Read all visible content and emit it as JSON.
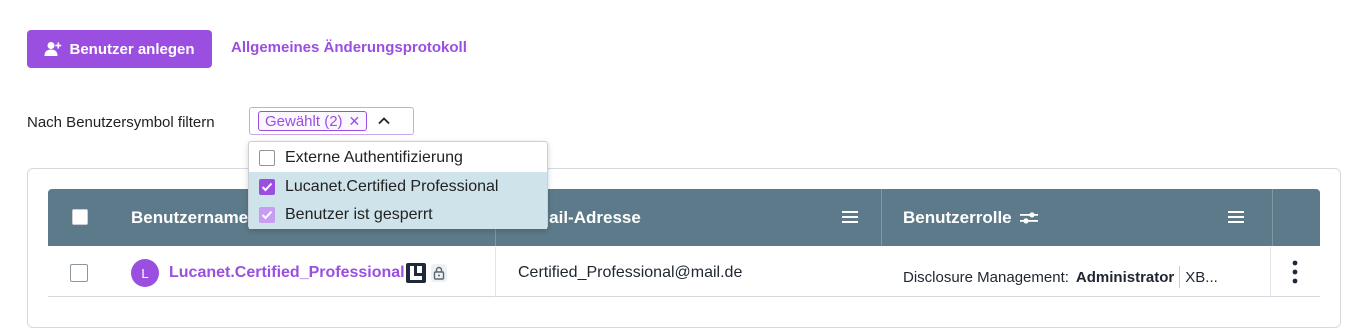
{
  "toolbar": {
    "create_user_label": "Benutzer anlegen",
    "change_log_label": "Allgemeines Änderungsprotokoll"
  },
  "filter": {
    "label": "Nach Benutzersymbol filtern",
    "chip_label": "Gewählt (2)",
    "chip_remove": "✕",
    "options": [
      {
        "label": "Externe Authentifizierung",
        "checked": false
      },
      {
        "label": "Lucanet.Certified Professional",
        "checked": true
      },
      {
        "label": "Benutzer ist gesperrt",
        "checked": true
      }
    ]
  },
  "table": {
    "columns": {
      "username": "Benutzername",
      "email": "E-Mail-Adresse",
      "role": "Benutzerrolle"
    },
    "rows": [
      {
        "avatar_initial": "L",
        "username": "Lucanet.Certified_Professional",
        "email": "Certified_Professional@mail.de",
        "role_context": "Disclosure Management:",
        "role_value": "Administrator",
        "role_more": "XB..."
      }
    ]
  },
  "colors": {
    "accent": "#9a4fe0",
    "table_header": "#5c7a8a",
    "selected_row": "#cfe3ea"
  }
}
